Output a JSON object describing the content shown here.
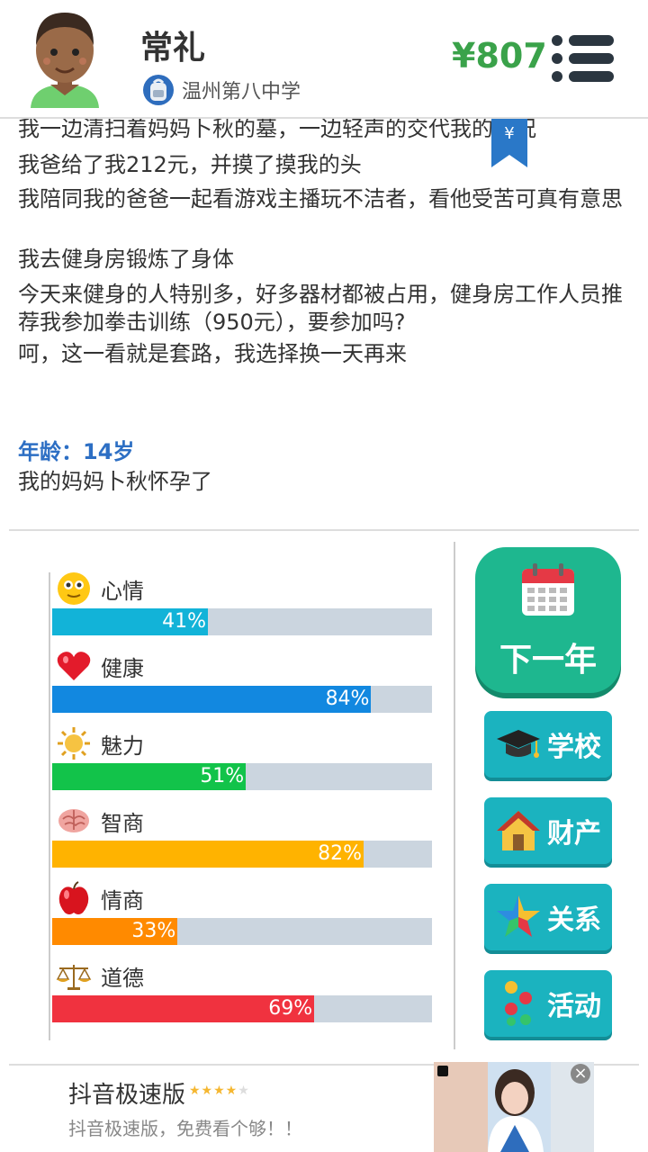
{
  "header": {
    "name": "常礼",
    "school": "温州第八中学",
    "money": "¥807"
  },
  "log": {
    "lines": [
      "我一边清扫着妈妈卜秋的墓，一边轻声的交代我的近况",
      "我爸给了我212元，并摸了摸我的头",
      "我陪同我的爸爸一起看游戏主播玩不洁者，看他受苦可真有意思",
      "我去健身房锻炼了身体",
      "今天来健身的人特别多，好多器材都被占用，健身房工作人员推荐我参加拳击训练（950元），要参加吗?",
      "呵，这一看就是套路，我选择换一天再来"
    ],
    "bookmark_symbol": "¥",
    "age": "年龄：14岁",
    "event": "我的妈妈卜秋怀孕了"
  },
  "stats": [
    {
      "label": "心情",
      "value": 41,
      "text": "41%",
      "color": "#12b3d8",
      "icon": "smiley-icon"
    },
    {
      "label": "健康",
      "value": 84,
      "text": "84%",
      "color": "#1288e0",
      "icon": "heart-icon"
    },
    {
      "label": "魅力",
      "value": 51,
      "text": "51%",
      "color": "#12c34a",
      "icon": "sun-icon"
    },
    {
      "label": "智商",
      "value": 82,
      "text": "82%",
      "color": "#ffb300",
      "icon": "brain-icon"
    },
    {
      "label": "情商",
      "value": 33,
      "text": "33%",
      "color": "#ff8a00",
      "icon": "apple-icon"
    },
    {
      "label": "道德",
      "value": 69,
      "text": "69%",
      "color": "#f0323f",
      "icon": "scales-icon"
    }
  ],
  "buttons": {
    "next_year": "下一年",
    "school": "学校",
    "property": "财产",
    "relations": "关系",
    "activities": "活动"
  },
  "ad": {
    "title": "抖音极速版",
    "rating": 4,
    "description": "抖音极速版，免费看个够！！",
    "close": "×"
  }
}
